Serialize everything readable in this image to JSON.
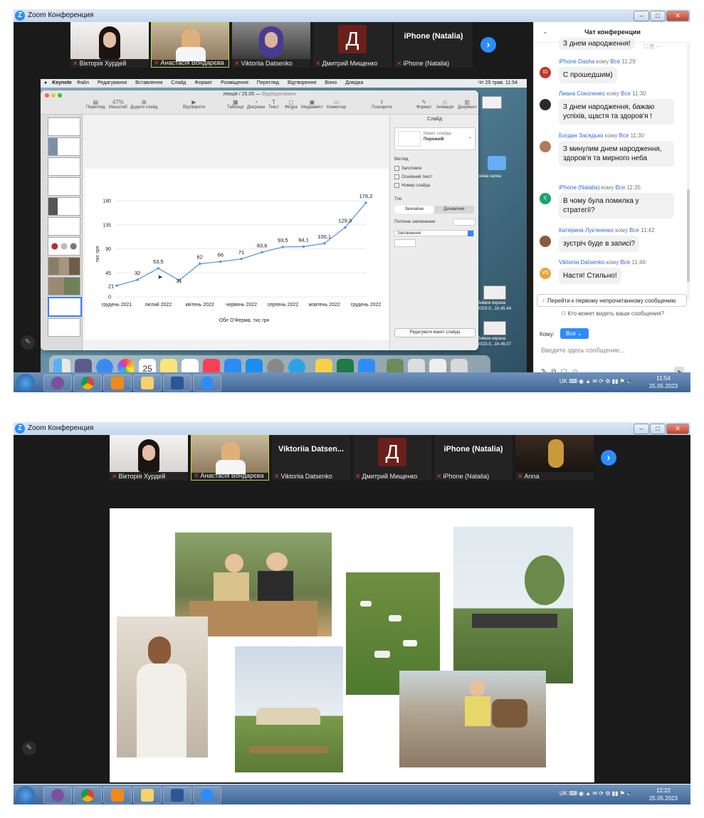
{
  "screen1": {
    "title": "Zoom Конференция",
    "participants": [
      {
        "name": "Вікторія Хурдей"
      },
      {
        "name": "Анастасія Вондарєва"
      },
      {
        "name": "Viktoriia Datsenko"
      },
      {
        "name": "Дмитрий Мищенко",
        "initial": "Д"
      },
      {
        "name": "iPhone (Natalia)",
        "big": "iPhone (Natalia)"
      }
    ],
    "mac": {
      "menubar": [
        "Keynote",
        "Файл",
        "Редагування",
        "Вставлення",
        "Слайд",
        "Формат",
        "Розміщення",
        "Перегляд",
        "Відтворення",
        "Вікно",
        "Довідка"
      ],
      "clock": "Чт 25 трав. 11:54",
      "document_title": "лекція / 25.05",
      "document_status": "Відредаговано",
      "toolbar": [
        "Перегляд",
        "Масштаб",
        "Додати слайд",
        "Відтворити",
        "Таблиця",
        "Діаграма",
        "Текст",
        "Фігура",
        "Медіавміст",
        "Коментар",
        "Поширити",
        "Формат",
        "Анімація",
        "Документ"
      ],
      "zoom": "47%",
      "inspector": {
        "tab": "Слайд",
        "layout_label": "Макет слайда",
        "layout_value": "Порожній",
        "view_label": "Вигляд",
        "checkboxes": [
          "Заголовок",
          "Основний текст",
          "Номер слайда"
        ],
        "bg_label": "Тло",
        "bg_tabs": [
          "Звичайне",
          "Динамічне"
        ],
        "fill_label": "Поточне заповнення",
        "fill_value": "Заповнення",
        "edit_button": "Редагувати макет слайда"
      },
      "desktop_labels": [
        "няна папка",
        "Знімок екрана",
        "2023-0...16.45.44",
        "Знімок екрана",
        "2023-0...16.46.07"
      ]
    },
    "chat": {
      "title": "Чат конференции",
      "messages": [
        {
          "sender": "",
          "to": "",
          "time": "",
          "text": "З днем народження!",
          "avatar": "",
          "color": "#3a3a3a"
        },
        {
          "sender": "iPhone Dasha",
          "to": "Все",
          "time": "11:29",
          "text": "С прошедшим)",
          "avatar": "ID",
          "color": "#c0392b"
        },
        {
          "sender": "Лиана Соколенко",
          "to": "Все",
          "time": "11:30",
          "text": "З днем народження, бажаю успіхів, щастя та здоров'я !",
          "avatar": "",
          "color": "#2b2b2b"
        },
        {
          "sender": "Богдан Засядько",
          "to": "Все",
          "time": "11:30",
          "text": "З минулим днем народження, здоров'я та мирного неба",
          "avatar": "",
          "color": "#b07b5a"
        },
        {
          "sender": "iPhone (Natalia)",
          "to": "Все",
          "time": "11:35",
          "text": "В чому була помилка у стратегії?",
          "avatar": "I(",
          "color": "#1aa36b"
        },
        {
          "sender": "Катерина Лук'яненко",
          "to": "Все",
          "time": "11:42",
          "text": "зустріч буде в записі?",
          "avatar": "",
          "color": "#8a5a3a"
        },
        {
          "sender": "Viktoriia Datsenko",
          "to": "Все",
          "time": "11:46",
          "text": "Настя! Стильно!",
          "avatar": "VD",
          "color": "#e8a33a"
        }
      ],
      "to_word": "кому",
      "jump_text": "Перейти к первому непрочитанному сообщению",
      "who_sees": "Кто может видеть ваши сообщения?",
      "to_label": "Кому:",
      "to_value": "Все",
      "input_placeholder": "Введите здесь сообщение..."
    },
    "taskbar": {
      "lang": "UK",
      "time": "11:54",
      "date": "25.05.2023"
    }
  },
  "screen2": {
    "title": "Zoom Конференция",
    "participants": [
      {
        "name": "Вікторія Хурдей"
      },
      {
        "name": "Анастасія Вондарєва"
      },
      {
        "name": "Viktoriia Datsenko",
        "big": "Viktoriia Datsen..."
      },
      {
        "name": "Дмитрий Мищенко",
        "initial": "Д"
      },
      {
        "name": "iPhone (Natalia)",
        "big": "iPhone (Natalia)"
      },
      {
        "name": "Anna"
      }
    ],
    "taskbar": {
      "lang": "UK",
      "time": "12:22",
      "date": "25.05.2023"
    }
  },
  "chart_data": {
    "type": "line",
    "title": "",
    "xlabel": "Обіг О'Ферма, тис грн",
    "ylabel": "тис грн",
    "ylim": [
      0,
      180
    ],
    "yticks": [
      0,
      45,
      90,
      135,
      180
    ],
    "grid": true,
    "x_tick_labels": [
      "грудень 2021",
      "лютий 2022",
      "квітень 2022",
      "червень 2022",
      "серпень 2022",
      "жовтень 2022",
      "грудень 2022"
    ],
    "values": [
      21,
      32,
      53.5,
      31,
      62,
      66,
      71,
      83.6,
      93.5,
      94.1,
      100.1,
      129.9,
      176.2
    ],
    "labels": [
      "21",
      "32",
      "53,5",
      "31",
      "62",
      "66",
      "71",
      "83,6",
      "93,5",
      "94,1",
      "100,1",
      "129,9",
      "176,2"
    ],
    "color": "#5b9bd5"
  }
}
